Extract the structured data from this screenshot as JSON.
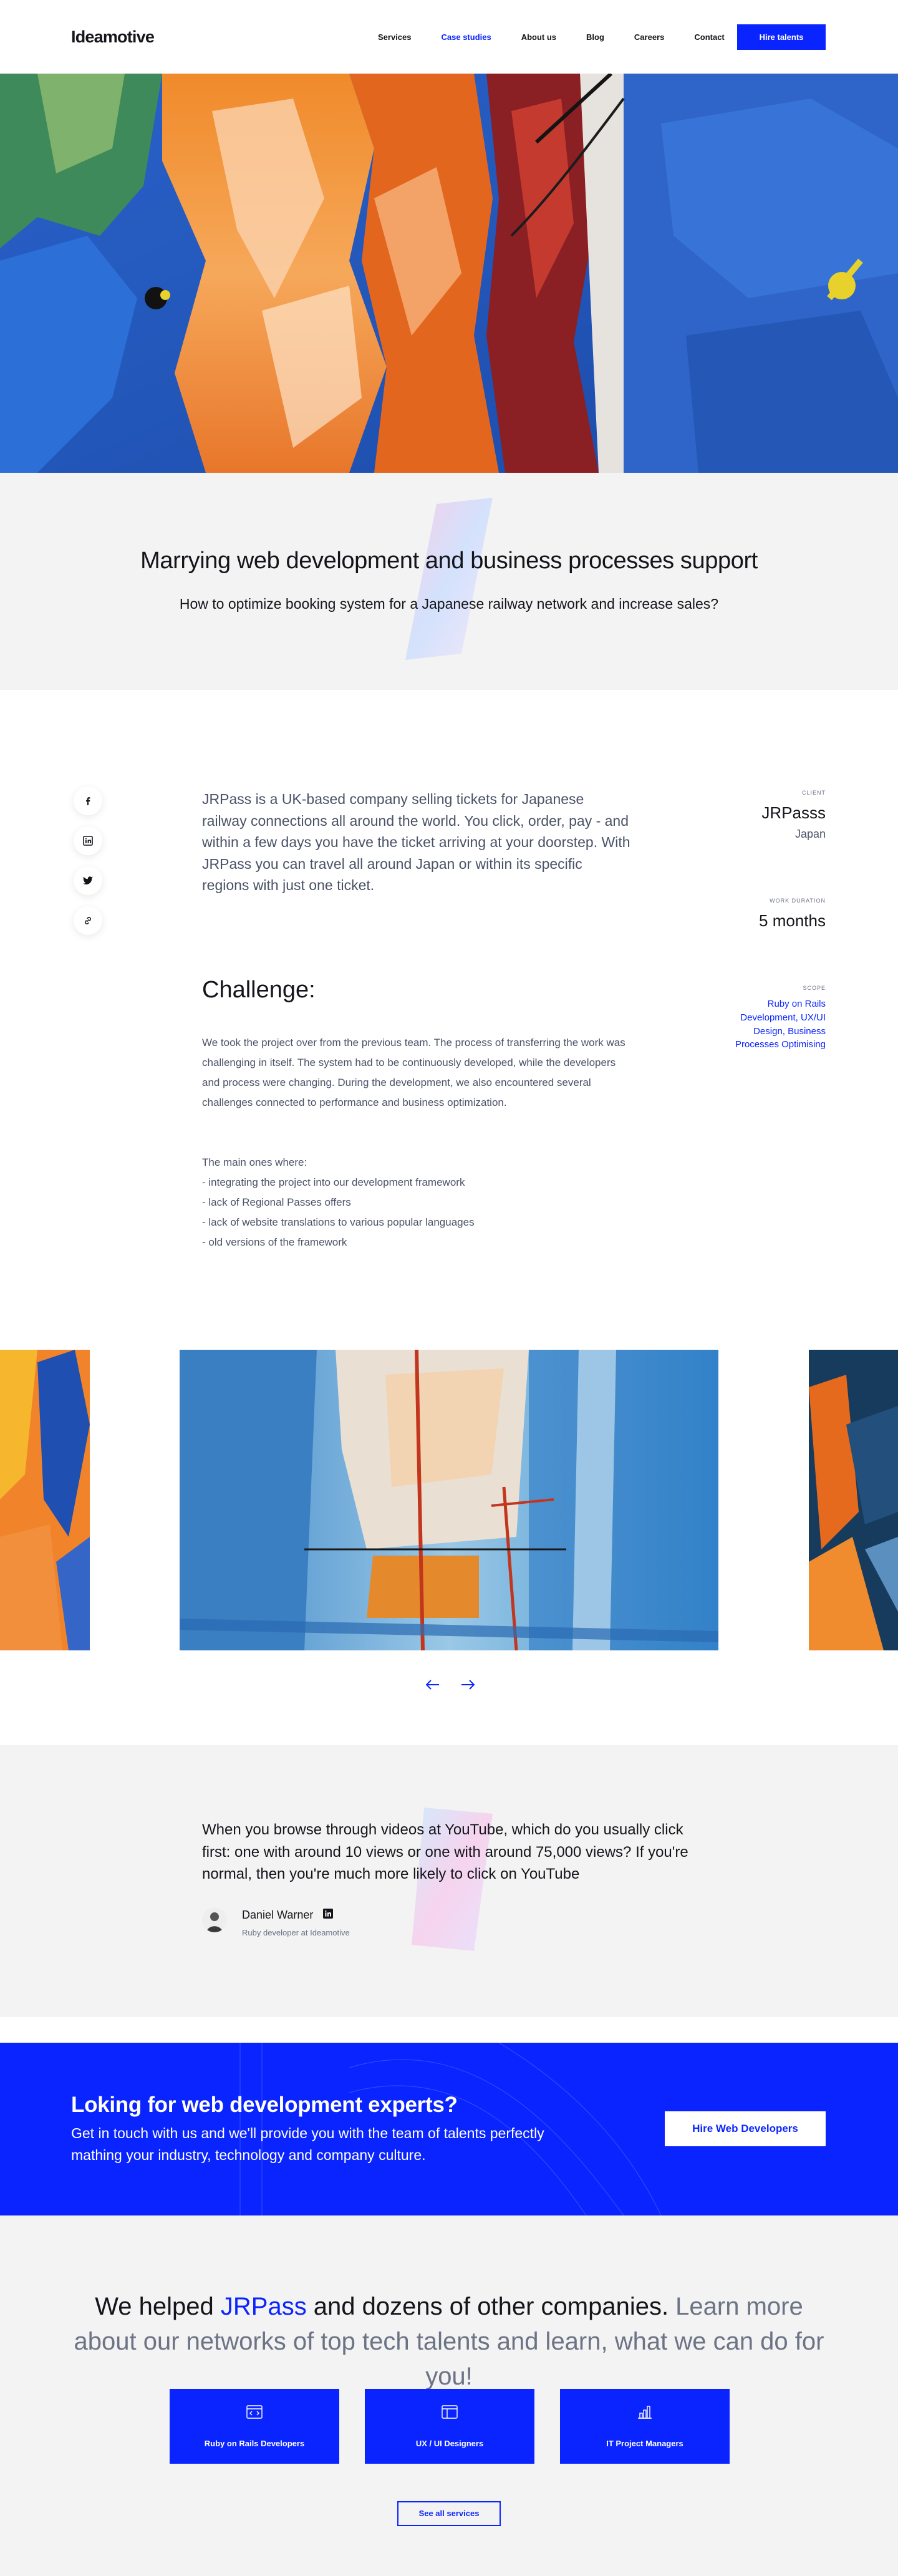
{
  "header": {
    "logo": "Ideamotive",
    "nav": [
      "Services",
      "Case studies",
      "About us",
      "Blog",
      "Careers",
      "Contact"
    ],
    "active_nav": "Case studies",
    "hire_button": "Hire talents"
  },
  "intro": {
    "title": "Marrying web development and business processes support",
    "subtitle": "How to optimize booking system for a Japanese railway network and increase sales?"
  },
  "social": [
    "facebook-icon",
    "linkedin-icon",
    "twitter-icon",
    "link-icon"
  ],
  "content": {
    "lead": "JRPass is a UK-based company selling tickets for Japanese railway connections all around the world. You click, order, pay - and within a few days you have the ticket arriving at your doorstep. With JRPass you can travel all around Japan or within its specific regions with just one ticket.",
    "challenge_title": "Challenge:",
    "challenge_body": "We took the project over from the previous team. The process of transferring the work was challenging in itself. The system had to be continuously developed, while the developers and process were changing. During the development, we also encountered several challenges connected to performance and business optimization.",
    "list_intro": "The main ones where:",
    "list": [
      "- integrating the project into our development framework",
      "- lack of Regional Passes offers",
      "- lack of website translations to various popular languages",
      "- old versions of the framework"
    ]
  },
  "meta": {
    "client_label": "CLIENT",
    "client": "JRPasss",
    "country": "Japan",
    "duration_label": "WORK DURATION",
    "duration": "5 months",
    "scope_label": "SCOPE",
    "scope": "Ruby on Rails Development, UX/UI Design, Business Processes Optimising"
  },
  "quote": {
    "text": "When you browse through videos at YouTube, which do you usually click first: one with around 10 views or one with around 75,000 views? If you're normal, then you're much more likely to click on YouTube",
    "name": "Daniel Warner",
    "role": "Ruby developer at Ideamotive"
  },
  "cta": {
    "title": "Loking for web development experts?",
    "text": "Get in touch with us and we'll provide you with the team of talents perfectly mathing your industry, technology and company culture.",
    "button": "Hire Web Developers"
  },
  "bottom": {
    "helped_a": "We helped ",
    "helped_brand": "JRPass",
    "helped_b": " and dozens of other companies. ",
    "helped_c": "Learn more about our networks of top tech talents and learn, what we can do for you!",
    "cards": [
      {
        "label": "Ruby on Rails Developers",
        "icon": "code-window-icon"
      },
      {
        "label": "UX / UI Designers",
        "icon": "layout-icon"
      },
      {
        "label": "IT Project Managers",
        "icon": "bar-chart-icon"
      }
    ],
    "see_all": "See all services"
  },
  "colors": {
    "brand_blue": "#0a24ff",
    "band_gray": "#f3f3f3",
    "text_dark": "#14151a",
    "text_muted": "#4a5266"
  }
}
